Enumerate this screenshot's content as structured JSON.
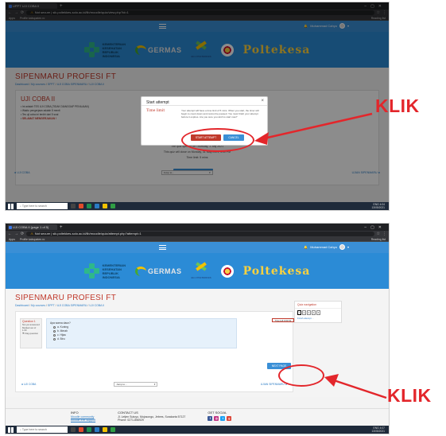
{
  "browser": {
    "tab1_title": "UPPT UJI COBA II",
    "tab2_title": "UJI COBA II (page 1 of 5)",
    "url1": "sik.poltekkes-solo.ac.id/lib/moodle/quiz/view.php?id=1",
    "url2": "sik.poltekkes-solo.ac.id/lib/moodle/quiz/attempt.php?attempt=1",
    "not_secure": "Not secure",
    "bookmarks": [
      "Apps",
      "Profile kabupaten.ro"
    ],
    "reading_list": "Reading list"
  },
  "header": {
    "username": "Muhammad Cahyo",
    "banner_org": [
      "KEMENTERIAN",
      "KESEHATAN",
      "REPUBLIK",
      "INDONESIA"
    ],
    "germas": "GERMAS",
    "poltekkes_label": "BLU POLTEKKES",
    "poltekesa": "Poltekesa"
  },
  "page": {
    "site_title": "SIPENMARU PROFESI FT",
    "breadcrumb1": [
      "Dashboard",
      "My courses",
      "SPFT",
      "UJI COBA SIPENMARU",
      "UJI COBA II"
    ],
    "breadcrumb2": [
      "Dashboard",
      "My courses",
      "SPFT",
      "UJI COBA SIPENMARU",
      "UJI COBA II"
    ]
  },
  "quiz_intro": {
    "title": "UJI COBA II",
    "bullets": [
      "Ini adalah TES UJI COBA (TIDAK DIANGGAP PENILAIAN)",
      "Waktu pengerjaan adalah 5 menit",
      "Tes uji coba ini terdiri dari 5 soal",
      "SELAMAT MENGERJAKAN !"
    ],
    "lines": [
      "Attempts allowed: 1",
      "The quiz opened on Thursday, 1 July 2021",
      "This quiz will close on Monday, 31 May 2021, 4:00 PM",
      "Time limit: 5 mins"
    ],
    "attempt_button": "ATTEMPT QUIZ NOW",
    "prev_link": "◄ UJI COBA",
    "jump_to": "Jump to...",
    "next_link": "UJIAN SIPENMARU ►"
  },
  "modal": {
    "title": "Start attempt",
    "close": "×",
    "section_label": "Time limit",
    "text": "Your attempt will have a time limit of 5 mins. When you start, the timer will begin to count down and cannot be paused. You must finish your attempt before it expires. Are you sure you wish to start now?",
    "start_button": "START ATTEMPT",
    "cancel_button": "CANCEL"
  },
  "question": {
    "label": "Question",
    "number": "1",
    "meta": [
      "Not yet answered",
      "Marked out of 1.00",
      "⚑ Flag question"
    ],
    "prompt": "Apa warna daun?",
    "options": [
      "a. Kuning",
      "b. Merah",
      "c. Hijau",
      "d. Biru"
    ],
    "time_left": "Time left 0:04:51",
    "next_button": "NEXT PAGE",
    "nav_title": "Quiz navigation",
    "nav_boxes": [
      "1",
      "2",
      "3",
      "4",
      "5"
    ],
    "finish_link": "Finish attempt ...",
    "prev_link": "◄ UJI COBA",
    "jump_to": "Jump to...",
    "next_link": "UJIAN SIPENMARU ►"
  },
  "footer": {
    "info_title": "INFO",
    "info_link": "Moodle community",
    "info_link2": "Moodle free support",
    "contact_title": "CONTACT US",
    "contact_address": "Jl. Letjen Sutoyo, Mojosongo, Jebres, Surakarta 57127",
    "contact_phone": "Phone: 0271-856929",
    "social_title": "GET SOCIAL"
  },
  "taskbar": {
    "search": "Type here to search",
    "time1": "4:04",
    "time2": "4:07",
    "date": "13/05/2021",
    "lang": "ENG"
  },
  "annotations": {
    "klik1": "KLIK",
    "klik2": "KLIK"
  },
  "colors": {
    "annotation_red": "#e3262b",
    "brand_blue": "#3a8fd6",
    "title_red": "#c0392b",
    "poltekesa_yellow": "#ffd23d"
  }
}
